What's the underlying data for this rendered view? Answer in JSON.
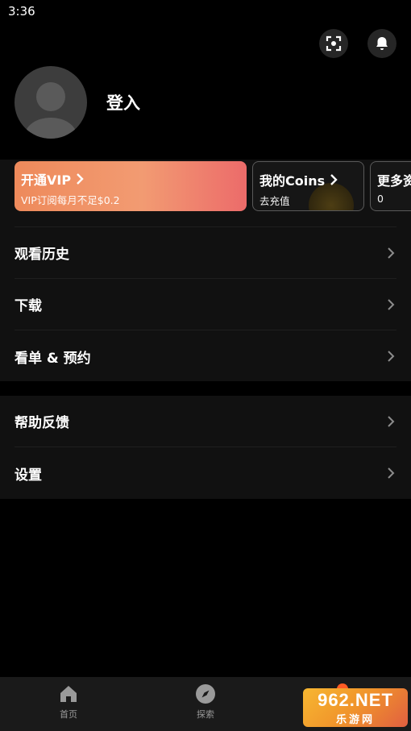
{
  "status_bar": {
    "time": "3:36"
  },
  "header": {
    "scan_icon": "scan-icon",
    "bell_icon": "bell-icon"
  },
  "profile": {
    "login_label": "登入"
  },
  "cards": {
    "vip": {
      "title": "开通VIP",
      "subtitle": "VIP订阅每月不足$0.2"
    },
    "coins": {
      "title": "我的Coins",
      "subtitle": "去充值"
    },
    "more": {
      "title": "更多资",
      "subtitle": "0"
    }
  },
  "menu_group_1": [
    {
      "label": "观看历史"
    },
    {
      "label": "下载"
    },
    {
      "label": "看单 & 预约"
    }
  ],
  "menu_group_2": [
    {
      "label": "帮助反馈"
    },
    {
      "label": "设置"
    }
  ],
  "bottom_nav": [
    {
      "label": "首页",
      "icon": "home-icon"
    },
    {
      "label": "探索",
      "icon": "compass-icon"
    }
  ],
  "watermark": {
    "top": "962.NET",
    "bottom": "乐游网"
  },
  "colors": {
    "vip_start": "#ee8a5b",
    "vip_end": "#ec6b6a",
    "background": "#000000",
    "panel": "#111111"
  }
}
